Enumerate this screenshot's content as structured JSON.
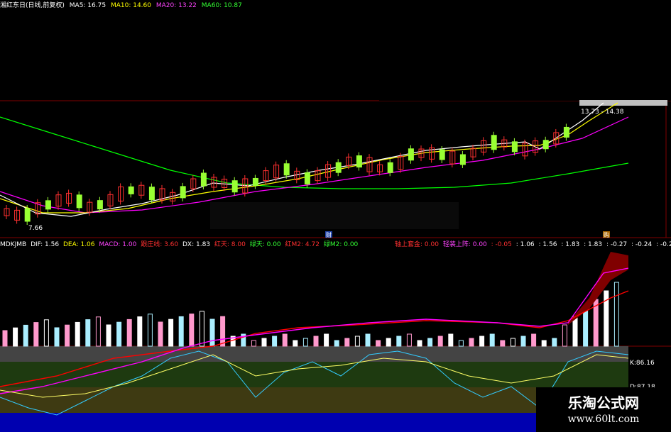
{
  "header": {
    "title": "湘红东日(日线,前复权)",
    "ma5": "MA5: 16.75",
    "ma10": "MA10: 14.60",
    "ma20": "MA20: 13.22",
    "ma60": "MA60: 10.87"
  },
  "price_chart": {
    "low_label": "7.66",
    "range_label": "13.73 - 14.38",
    "marker_cai": "财",
    "marker_gou": "购"
  },
  "indicator": {
    "name": "MDKJMB",
    "dif": "DIF: 1.56",
    "dea": "DEA: 1.06",
    "macd": "MACD: 1.00",
    "zlx": "跟庄线: 3.60",
    "dx": "DX: 1.83",
    "hongtian": "红天: 8.00",
    "lvtian": "绿天: 0.00",
    "hongm2": "红M2: 4.72",
    "lvm2": "绿M2: 0.00",
    "zhoushang": "轴上套金: 0.00",
    "qingjian": "轻装上阵: 0.00",
    "v1": ": -0.05",
    "v2": ": 1.06",
    "v3": ": 1.56",
    "v4": ": 1.83",
    "v5": ": 1.83",
    "v6": ": -0.27",
    "v7": ": -0.24",
    "v8": ": -0.2",
    "k_label": "K:86.16",
    "d_label": "D:87.18"
  },
  "watermark": {
    "title": "乐淘公式网",
    "url": "www.60lt.com"
  },
  "colors": {
    "header_white": "#ffffff",
    "ma5": "#ffffff",
    "ma10": "#ffff00",
    "ma20": "#ff00ff",
    "ma60": "#00ff00",
    "candle_up": "#ff3030",
    "candle_down": "#99ff33",
    "dif": "#ffffff",
    "dea": "#ffff00",
    "macd": "#ff00ff",
    "zlx": "#ff0000",
    "grid_red": "#800000"
  }
}
